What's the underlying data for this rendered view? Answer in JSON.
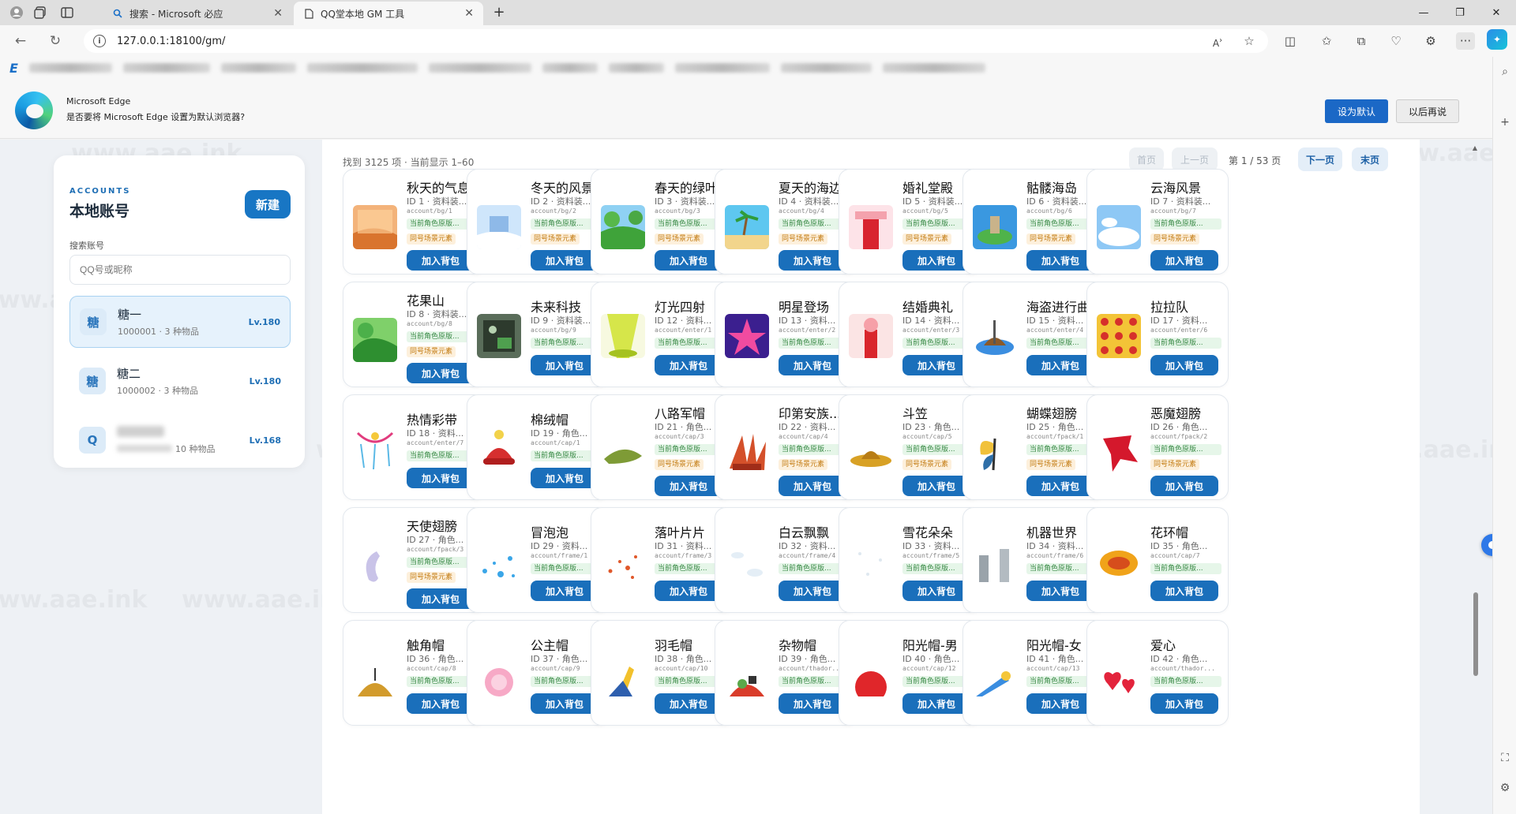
{
  "browser": {
    "tabs": [
      {
        "title": "搜索 - Microsoft 必应",
        "active": false,
        "icon": "search-icon"
      },
      {
        "title": "QQ堂本地 GM 工具",
        "active": true,
        "icon": "page-icon"
      }
    ],
    "url": "127.0.0.1:18100/gm/",
    "notification": {
      "title": "Microsoft Edge",
      "message": "是否要将 Microsoft Edge 设置为默认浏览器?",
      "primary_button": "设为默认",
      "secondary_button": "以后再说"
    }
  },
  "accounts": {
    "eyebrow": "ACCOUNTS",
    "title": "本地账号",
    "new_button": "新建",
    "search_label": "搜索账号",
    "search_placeholder": "QQ号或昵称",
    "list": [
      {
        "avatar": "糖",
        "name": "糖一",
        "meta": "1000001 · 3 种物品",
        "level": "Lv.180",
        "selected": true
      },
      {
        "avatar": "糖",
        "name": "糖二",
        "meta": "1000002 · 3 种物品",
        "level": "Lv.180",
        "selected": false
      },
      {
        "avatar": "Q",
        "name": "",
        "meta": "10 种物品",
        "level": "Lv.168",
        "selected": false
      }
    ]
  },
  "catalog": {
    "summary": "找到 3125 项 · 当前显示 1–60",
    "pager": {
      "first": "首页",
      "prev": "上一页",
      "info": "第 1 / 53 页",
      "next": "下一页",
      "last": "末页"
    },
    "tag_current": "当前角色原版...",
    "tag_same": "同号场景元素",
    "add_label": "加入背包",
    "items": [
      {
        "name": "秋天的气息",
        "id": "ID 1 · 资料装...",
        "path": "account/bg/1",
        "same": true,
        "thumb": "autumn"
      },
      {
        "name": "冬天的风景",
        "id": "ID 2 · 资料装...",
        "path": "account/bg/2",
        "same": true,
        "thumb": "winter"
      },
      {
        "name": "春天的绿叶",
        "id": "ID 3 · 资料装...",
        "path": "account/bg/3",
        "same": true,
        "thumb": "spring"
      },
      {
        "name": "夏天的海边",
        "id": "ID 4 · 资料装...",
        "path": "account/bg/4",
        "same": true,
        "thumb": "beach"
      },
      {
        "name": "婚礼堂殿",
        "id": "ID 5 · 资料装...",
        "path": "account/bg/5",
        "same": true,
        "thumb": "wedding"
      },
      {
        "name": "骷髅海岛",
        "id": "ID 6 · 资料装...",
        "path": "account/bg/6",
        "same": true,
        "thumb": "island"
      },
      {
        "name": "云海风景",
        "id": "ID 7 · 资料装...",
        "path": "account/bg/7",
        "same": true,
        "thumb": "cloud"
      },
      {
        "name": "花果山",
        "id": "ID 8 · 资料装...",
        "path": "account/bg/8",
        "same": true,
        "thumb": "mountain"
      },
      {
        "name": "未来科技",
        "id": "ID 9 · 资料装...",
        "path": "account/bg/9",
        "same": false,
        "thumb": "tech"
      },
      {
        "name": "灯光四射",
        "id": "ID 12 · 资料...",
        "path": "account/enter/1",
        "same": false,
        "thumb": "light"
      },
      {
        "name": "明星登场",
        "id": "ID 13 · 资料...",
        "path": "account/enter/2",
        "same": false,
        "thumb": "star"
      },
      {
        "name": "结婚典礼",
        "id": "ID 14 · 资料...",
        "path": "account/enter/3",
        "same": false,
        "thumb": "ceremony"
      },
      {
        "name": "海盗进行曲",
        "id": "ID 15 · 资料...",
        "path": "account/enter/4",
        "same": false,
        "thumb": "pirate"
      },
      {
        "name": "拉拉队",
        "id": "ID 17 · 资料...",
        "path": "account/enter/6",
        "same": false,
        "thumb": "cheer"
      },
      {
        "name": "热情彩带",
        "id": "ID 18 · 资料...",
        "path": "account/enter/7",
        "same": false,
        "thumb": "ribbon"
      },
      {
        "name": "棉绒帽",
        "id": "ID 19 · 角色...",
        "path": "account/cap/1",
        "same": false,
        "thumb": "wool"
      },
      {
        "name": "八路军帽",
        "id": "ID 21 · 角色...",
        "path": "account/cap/3",
        "same": true,
        "thumb": "army"
      },
      {
        "name": "印第安族...",
        "id": "ID 22 · 资料...",
        "path": "account/cap/4",
        "same": true,
        "thumb": "indian"
      },
      {
        "name": "斗笠",
        "id": "ID 23 · 角色...",
        "path": "account/cap/5",
        "same": true,
        "thumb": "hat"
      },
      {
        "name": "蝴蝶翅膀",
        "id": "ID 25 · 角色...",
        "path": "account/fpack/1",
        "same": true,
        "thumb": "butterfly"
      },
      {
        "name": "恶魔翅膀",
        "id": "ID 26 · 角色...",
        "path": "account/fpack/2",
        "same": true,
        "thumb": "devil"
      },
      {
        "name": "天使翅膀",
        "id": "ID 27 · 角色...",
        "path": "account/fpack/3",
        "same": true,
        "thumb": "angel"
      },
      {
        "name": "冒泡泡",
        "id": "ID 29 · 资料...",
        "path": "account/frame/1",
        "same": false,
        "thumb": "bubble"
      },
      {
        "name": "落叶片片",
        "id": "ID 31 · 资料...",
        "path": "account/frame/3",
        "same": false,
        "thumb": "leaf"
      },
      {
        "name": "白云飘飘",
        "id": "ID 32 · 资料...",
        "path": "account/frame/4",
        "same": false,
        "thumb": "whitecloud"
      },
      {
        "name": "雪花朵朵",
        "id": "ID 33 · 资料...",
        "path": "account/frame/5",
        "same": false,
        "thumb": "snow"
      },
      {
        "name": "机器世界",
        "id": "ID 34 · 资料...",
        "path": "account/frame/6",
        "same": false,
        "thumb": "machine"
      },
      {
        "name": "花环帽",
        "id": "ID 35 · 角色...",
        "path": "account/cap/7",
        "same": false,
        "thumb": "wreath"
      },
      {
        "name": "触角帽",
        "id": "ID 36 · 角色...",
        "path": "account/cap/8",
        "same": false,
        "thumb": "antenna"
      },
      {
        "name": "公主帽",
        "id": "ID 37 · 角色...",
        "path": "account/cap/9",
        "same": false,
        "thumb": "princess"
      },
      {
        "name": "羽毛帽",
        "id": "ID 38 · 角色...",
        "path": "account/cap/10",
        "same": false,
        "thumb": "feather"
      },
      {
        "name": "杂物帽",
        "id": "ID 39 · 角色...",
        "path": "account/thador...",
        "same": false,
        "thumb": "junk"
      },
      {
        "name": "阳光帽-男",
        "id": "ID 40 · 角色...",
        "path": "account/cap/12",
        "same": false,
        "thumb": "sunm"
      },
      {
        "name": "阳光帽-女",
        "id": "ID 41 · 角色...",
        "path": "account/cap/13",
        "same": false,
        "thumb": "sunf"
      },
      {
        "name": "爱心",
        "id": "ID 42 · 角色...",
        "path": "account/thador...",
        "same": false,
        "thumb": "heart"
      }
    ]
  },
  "colors": {
    "accent": "#1a6fbb",
    "panel_bg": "#eef1f5"
  },
  "watermark": "www.aae.ink"
}
